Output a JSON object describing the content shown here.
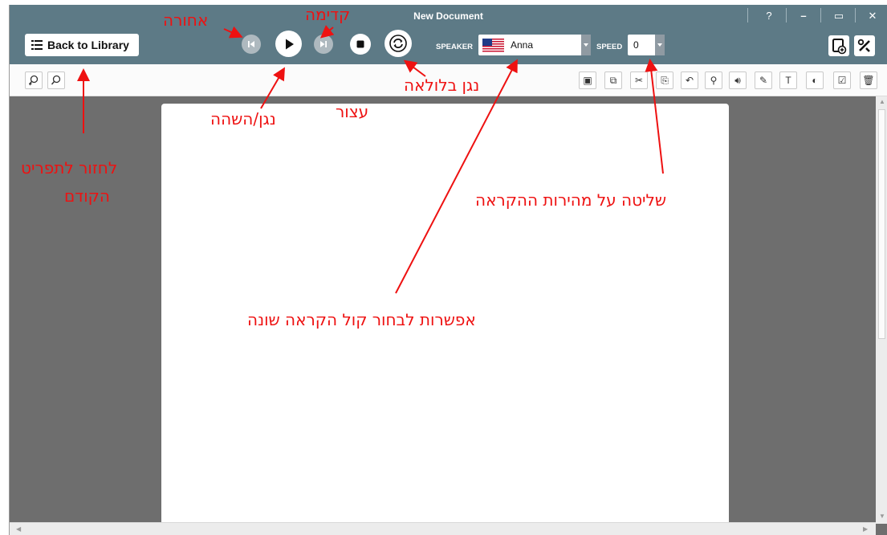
{
  "window": {
    "title": "New Document"
  },
  "library": {
    "back_label": "Back to Library"
  },
  "player": {
    "prev_icon": "skip-previous-icon",
    "play_icon": "play-pause-icon",
    "next_icon": "skip-next-icon",
    "stop_icon": "stop-icon",
    "loop_icon": "loop-icon"
  },
  "speaker": {
    "label": "SPEAKER",
    "value": "Anna",
    "flag_icon": "us-flag-icon"
  },
  "speed": {
    "label": "SPEED",
    "value": "0"
  },
  "window_controls": {
    "help": "?",
    "minimize": "–",
    "maximize": "▭",
    "close": "✕"
  },
  "right_buttons": [
    "add-document-icon",
    "tools-icon"
  ],
  "toolbar": {
    "left": [
      "zoom-in-icon",
      "zoom-out-icon"
    ],
    "right": [
      "save-icon",
      "copy-icon",
      "cut-icon",
      "paste-icon",
      "undo-icon",
      "search-icon",
      "read-aloud-icon",
      "highlight-icon",
      "text-cursor-icon",
      "eraser-icon",
      "checkbox-icon",
      "delete-icon"
    ]
  },
  "annotations": {
    "back": "אחורה",
    "forward": "קדימה",
    "play_pause": "נגן/השהה",
    "stop": "עצור",
    "loop": "נגן בלולאה",
    "return_prev_line1": "לחזור לתפריט",
    "return_prev_line2": "הקודם",
    "speed_control": "שליטה על מהירות ההקראה",
    "choose_voice": "אפשרות לבחור קול הקראה שונה"
  },
  "colors": {
    "titlebar": "#5d7a86",
    "workspace": "#6e6e6e",
    "annotation": "#ee1111"
  }
}
